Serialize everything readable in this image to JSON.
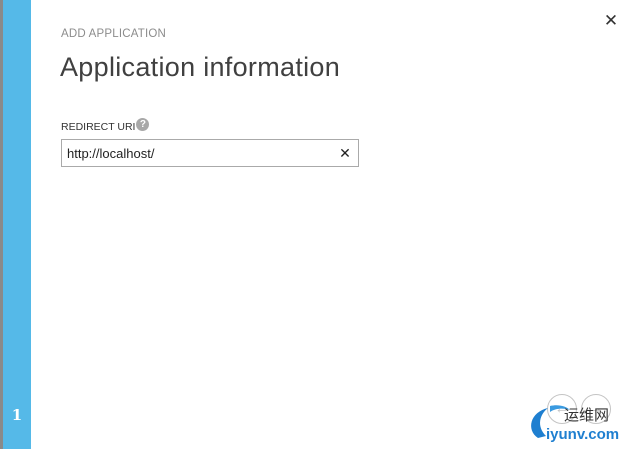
{
  "stepper": {
    "current_step": "1"
  },
  "dialog": {
    "overline": "ADD APPLICATION",
    "title": "Application information",
    "close_icon": "close-icon"
  },
  "redirect_uri": {
    "label": "REDIRECT URI",
    "help_icon_glyph": "?",
    "value": "http://localhost/",
    "clear_icon": "clear-icon"
  },
  "navigation": {
    "prev_icon": "arrow-left-icon",
    "next_icon": "arrow-right-icon"
  },
  "watermark": {
    "text_top": "运维网",
    "text_bottom": "iyunv.com"
  },
  "colors": {
    "step_bar": "#55b9e8",
    "title_text": "#404040",
    "overline_text": "#8c8c8c",
    "watermark_blue": "#1f7fd0"
  }
}
